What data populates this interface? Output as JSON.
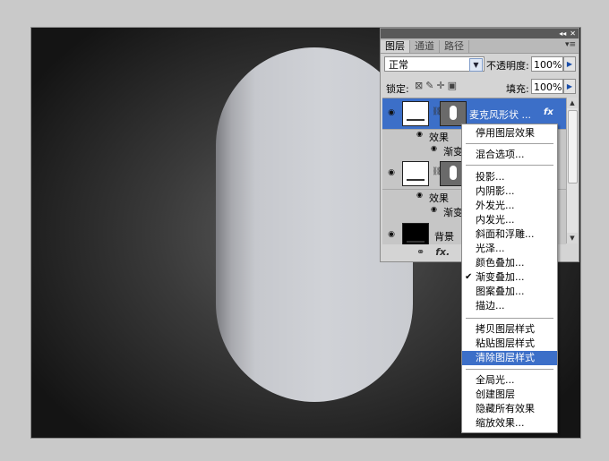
{
  "panel": {
    "tabs": [
      "图层",
      "通道",
      "路径"
    ],
    "blend_mode": "正常",
    "opacity_label": "不透明度:",
    "opacity_value": "100%",
    "lock_label": "锁定:",
    "fill_label": "填充:",
    "fill_value": "100%"
  },
  "layers": [
    {
      "name": "麦克风形状 ...",
      "selected": true,
      "effects_label": "效果",
      "effect": "渐变"
    },
    {
      "name": "",
      "selected": false,
      "effects_label": "效果",
      "effect": "渐变"
    },
    {
      "name": "背景",
      "selected": false
    }
  ],
  "menu": {
    "items": [
      "停用图层效果",
      "混合选项...",
      "投影...",
      "内阴影...",
      "外发光...",
      "内发光...",
      "斜面和浮雕...",
      "光泽...",
      "颜色叠加...",
      "渐变叠加...",
      "图案叠加...",
      "描边...",
      "拷贝图层样式",
      "粘贴图层样式",
      "清除图层样式",
      "全局光...",
      "创建图层",
      "隐藏所有效果",
      "缩放效果..."
    ],
    "checked_item": "渐变叠加...",
    "highlighted_item": "清除图层样式"
  },
  "colors": {
    "selection": "#3c6fc8",
    "canvas_bg": "#1a1a1a",
    "shape": "#c6c8cd"
  }
}
